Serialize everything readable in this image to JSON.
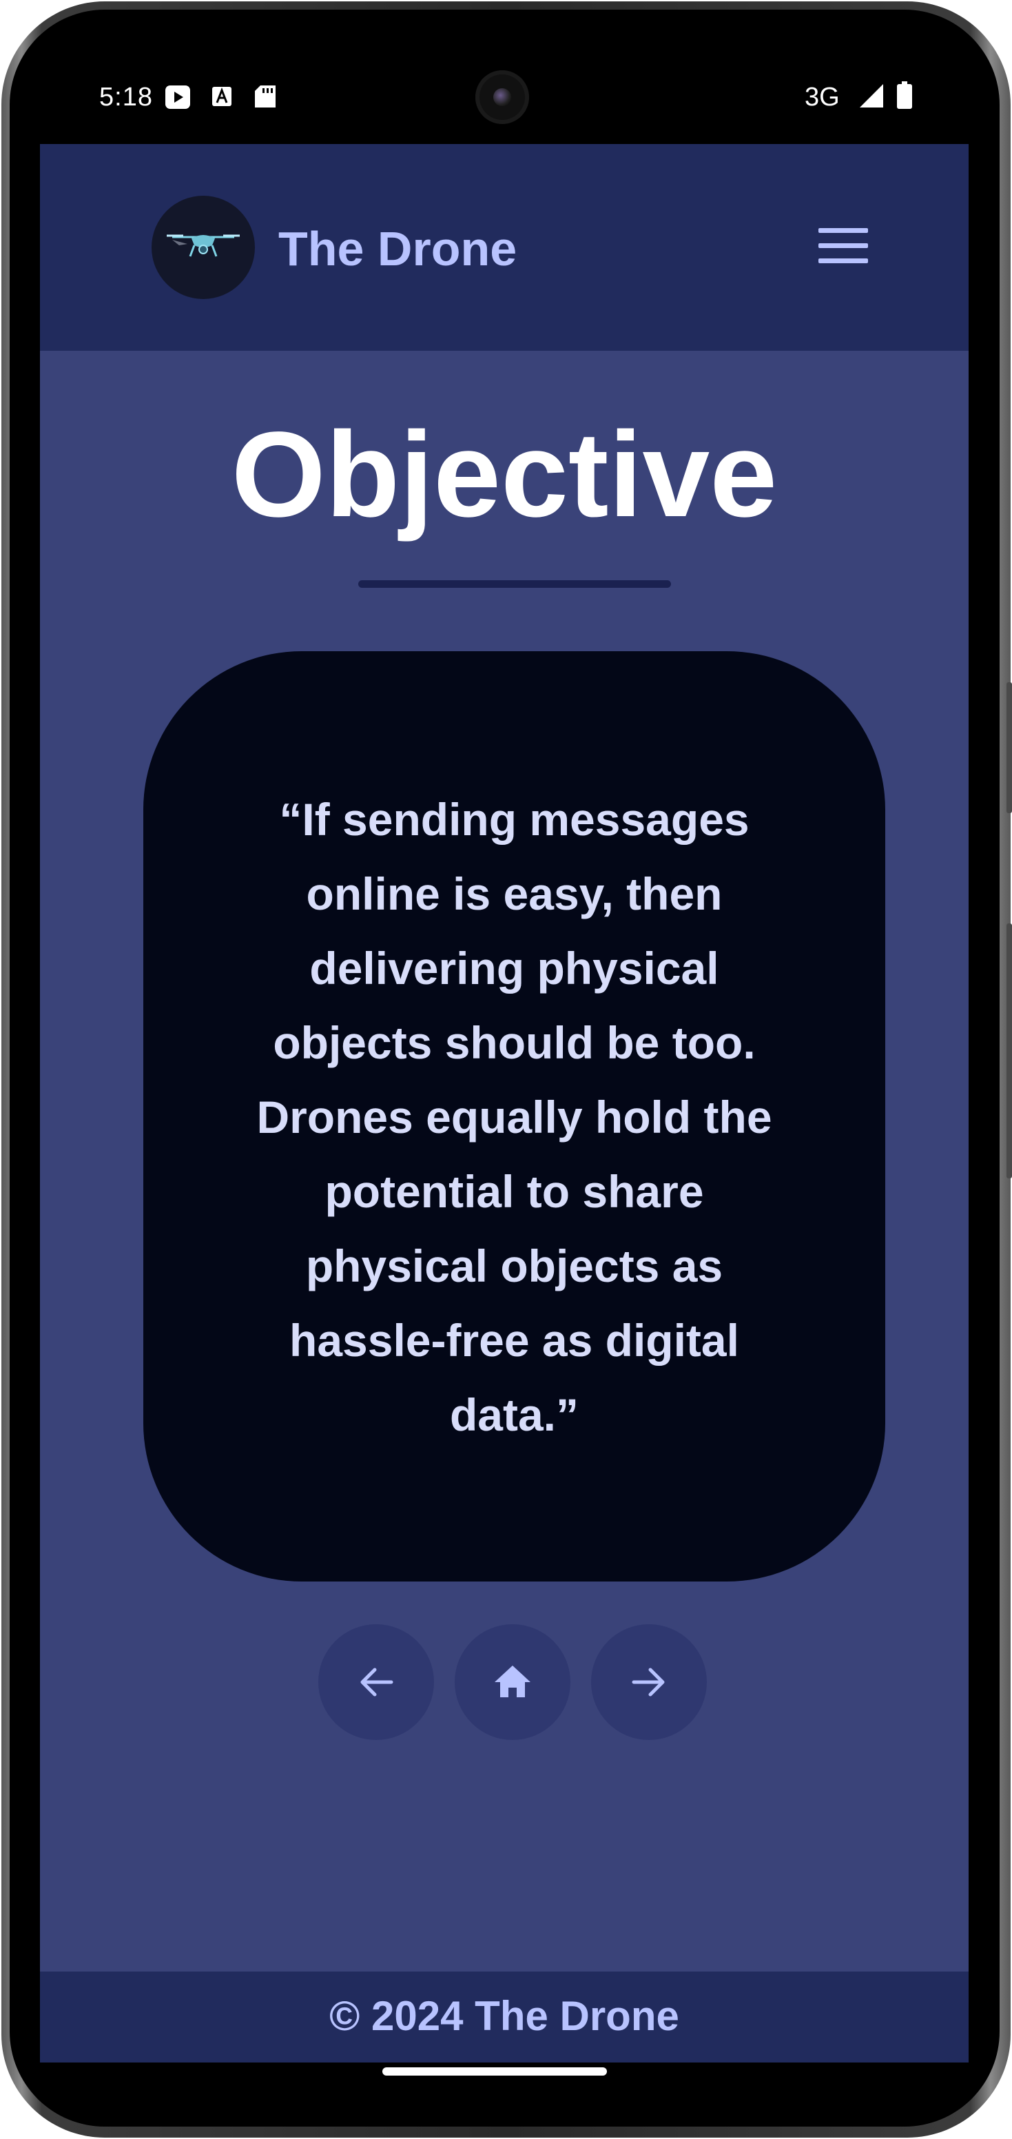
{
  "status_bar": {
    "time": "5:18",
    "network": "3G",
    "icons": [
      "play-store-icon",
      "a-font-icon",
      "sd-card-icon",
      "signal-icon",
      "battery-icon"
    ]
  },
  "header": {
    "brand": "The Drone",
    "logo_icon": "drone-logo-icon",
    "menu_icon": "hamburger-menu-icon"
  },
  "main": {
    "title": "Objective",
    "quote": "“If sending messages online is easy, then delivering physical objects should be too. Drones equally hold the potential to share physical objects as hassle-free as digital data.”"
  },
  "navigation": {
    "buttons": [
      {
        "icon": "arrow-left-icon"
      },
      {
        "icon": "home-icon"
      },
      {
        "icon": "arrow-right-icon"
      }
    ]
  },
  "footer": {
    "text": "© 2024 The Drone"
  },
  "colors": {
    "page_bg": "#3a4379",
    "header_bg": "#212b5d",
    "accent": "#b8c3ff",
    "card_bg": "#030717",
    "quote_text": "#d8ddfa"
  }
}
